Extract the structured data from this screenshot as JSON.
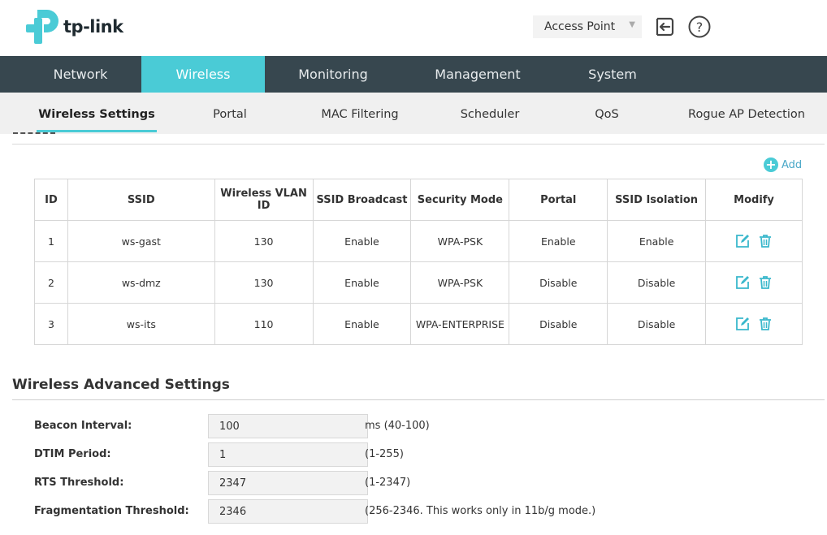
{
  "brand": {
    "name": "tp-link",
    "color": "#4acbd6"
  },
  "header": {
    "mode_select": "Access Point",
    "logout_icon": "logout-icon",
    "help_icon": "help-icon"
  },
  "nav": {
    "items": [
      {
        "label": "Network",
        "active": false
      },
      {
        "label": "Wireless",
        "active": true
      },
      {
        "label": "Monitoring",
        "active": false
      },
      {
        "label": "Management",
        "active": false
      },
      {
        "label": "System",
        "active": false
      }
    ]
  },
  "subnav": {
    "items": [
      {
        "label": "Wireless Settings",
        "active": true
      },
      {
        "label": "Portal",
        "active": false
      },
      {
        "label": "MAC Filtering",
        "active": false
      },
      {
        "label": "Scheduler",
        "active": false
      },
      {
        "label": "QoS",
        "active": false
      },
      {
        "label": "Rogue AP Detection",
        "active": false
      }
    ]
  },
  "ssid_table": {
    "add_label": "Add",
    "columns": [
      "ID",
      "SSID",
      "Wireless VLAN ID",
      "SSID Broadcast",
      "Security Mode",
      "Portal",
      "SSID Isolation",
      "Modify"
    ],
    "rows": [
      [
        "1",
        "ws-gast",
        "130",
        "Enable",
        "WPA-PSK",
        "Enable",
        "Enable"
      ],
      [
        "2",
        "ws-dmz",
        "130",
        "Enable",
        "WPA-PSK",
        "Disable",
        "Disable"
      ],
      [
        "3",
        "ws-its",
        "110",
        "Enable",
        "WPA-ENTERPRISE",
        "Disable",
        "Disable"
      ]
    ]
  },
  "advanced": {
    "title": "Wireless Advanced Settings",
    "fields": [
      {
        "label": "Beacon Interval:",
        "value": "100",
        "hint": "ms (40-100)"
      },
      {
        "label": "DTIM Period:",
        "value": "1",
        "hint": "(1-255)"
      },
      {
        "label": "RTS Threshold:",
        "value": "2347",
        "hint": "(1-2347)"
      },
      {
        "label": "Fragmentation Threshold:",
        "value": "2346",
        "hint": "(256-2346. This works only in 11b/g mode.)"
      }
    ]
  }
}
